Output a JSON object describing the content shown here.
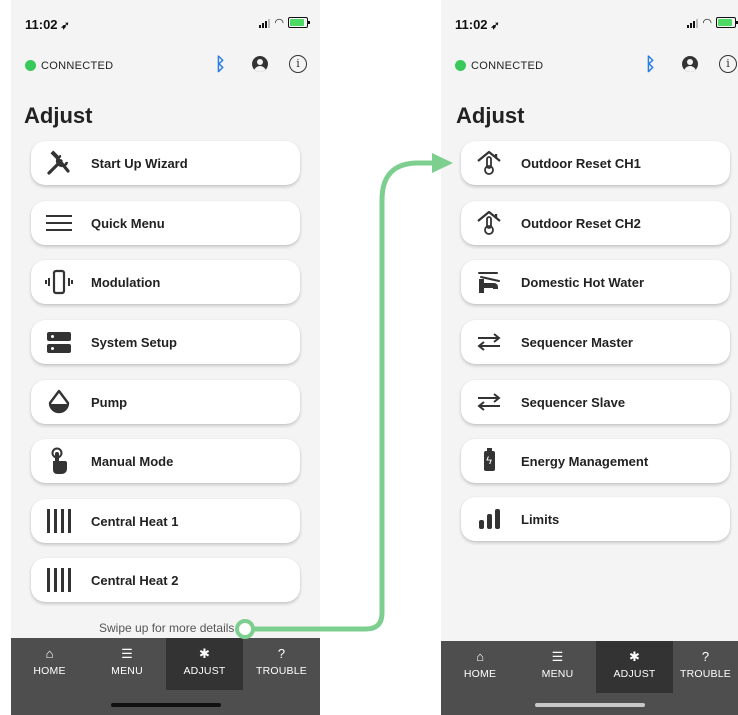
{
  "status_bar": {
    "time": "11:02"
  },
  "connection": {
    "status": "CONNECTED",
    "dot_color": "#38c95a",
    "bluetooth_color": "#2b7de9"
  },
  "screen_title": "Adjust",
  "left_menu": [
    {
      "label": "Start Up Wizard",
      "icon": "tools-icon"
    },
    {
      "label": "Quick Menu",
      "icon": "menu-lines-icon"
    },
    {
      "label": "Modulation",
      "icon": "vibrate-icon"
    },
    {
      "label": "System Setup",
      "icon": "server-icon"
    },
    {
      "label": "Pump",
      "icon": "drop-icon"
    },
    {
      "label": "Manual Mode",
      "icon": "hand-pointer-icon"
    },
    {
      "label": "Central Heat 1",
      "icon": "radiator-icon"
    },
    {
      "label": "Central Heat 2",
      "icon": "radiator-icon"
    }
  ],
  "right_menu": [
    {
      "label": "Outdoor Reset CH1",
      "icon": "house-thermometer-icon"
    },
    {
      "label": "Outdoor Reset CH2",
      "icon": "house-thermometer-icon"
    },
    {
      "label": "Domestic Hot Water",
      "icon": "faucet-icon"
    },
    {
      "label": "Sequencer Master",
      "icon": "exchange-icon"
    },
    {
      "label": "Sequencer Slave",
      "icon": "exchange-icon"
    },
    {
      "label": "Energy Management",
      "icon": "battery-icon"
    },
    {
      "label": "Limits",
      "icon": "bar-levels-icon"
    }
  ],
  "swipe_hint": "Swipe up for more details",
  "tabs": [
    {
      "label": "HOME",
      "icon": "home-icon"
    },
    {
      "label": "MENU",
      "icon": "list-icon"
    },
    {
      "label": "ADJUST",
      "icon": "gear-icon",
      "active": true
    },
    {
      "label": "TROUBLE",
      "icon": "question-icon"
    }
  ],
  "arrow_color": "#7dcf8f"
}
